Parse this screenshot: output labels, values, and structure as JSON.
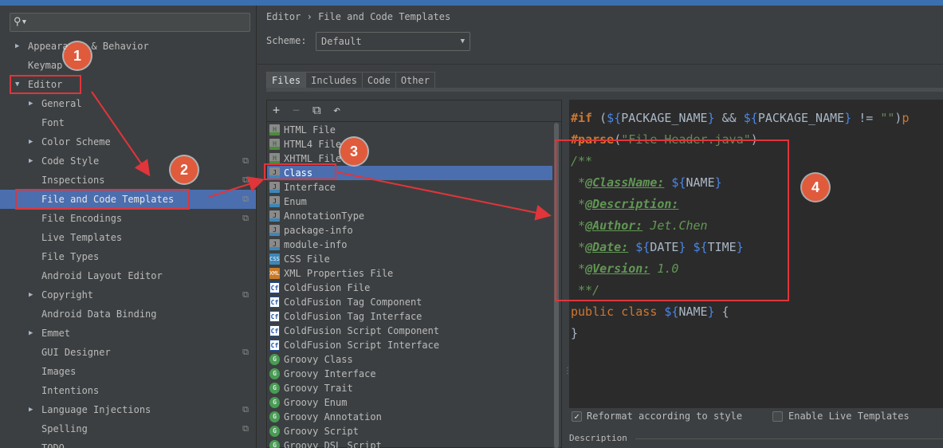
{
  "settings_tree": {
    "search_placeholder": "",
    "items": [
      {
        "label": "Appearance & Behavior",
        "expander": "right",
        "indent": 0,
        "project": false,
        "selected": false
      },
      {
        "label": "Keymap",
        "expander": "",
        "indent": 0,
        "project": false,
        "selected": false
      },
      {
        "label": "Editor",
        "expander": "down",
        "indent": 0,
        "project": false,
        "selected": false
      },
      {
        "label": "General",
        "expander": "right",
        "indent": 1,
        "project": false,
        "selected": false
      },
      {
        "label": "Font",
        "expander": "",
        "indent": 1,
        "project": false,
        "selected": false
      },
      {
        "label": "Color Scheme",
        "expander": "right",
        "indent": 1,
        "project": false,
        "selected": false
      },
      {
        "label": "Code Style",
        "expander": "right",
        "indent": 1,
        "project": true,
        "selected": false
      },
      {
        "label": "Inspections",
        "expander": "",
        "indent": 1,
        "project": true,
        "selected": false
      },
      {
        "label": "File and Code Templates",
        "expander": "",
        "indent": 1,
        "project": true,
        "selected": true
      },
      {
        "label": "File Encodings",
        "expander": "",
        "indent": 1,
        "project": true,
        "selected": false
      },
      {
        "label": "Live Templates",
        "expander": "",
        "indent": 1,
        "project": false,
        "selected": false
      },
      {
        "label": "File Types",
        "expander": "",
        "indent": 1,
        "project": false,
        "selected": false
      },
      {
        "label": "Android Layout Editor",
        "expander": "",
        "indent": 1,
        "project": false,
        "selected": false
      },
      {
        "label": "Copyright",
        "expander": "right",
        "indent": 1,
        "project": true,
        "selected": false
      },
      {
        "label": "Android Data Binding",
        "expander": "",
        "indent": 1,
        "project": false,
        "selected": false
      },
      {
        "label": "Emmet",
        "expander": "right",
        "indent": 1,
        "project": false,
        "selected": false
      },
      {
        "label": "GUI Designer",
        "expander": "",
        "indent": 1,
        "project": true,
        "selected": false
      },
      {
        "label": "Images",
        "expander": "",
        "indent": 1,
        "project": false,
        "selected": false
      },
      {
        "label": "Intentions",
        "expander": "",
        "indent": 1,
        "project": false,
        "selected": false
      },
      {
        "label": "Language Injections",
        "expander": "right",
        "indent": 1,
        "project": true,
        "selected": false
      },
      {
        "label": "Spelling",
        "expander": "",
        "indent": 1,
        "project": true,
        "selected": false
      },
      {
        "label": "TODO",
        "expander": "",
        "indent": 1,
        "project": false,
        "selected": false
      }
    ]
  },
  "header": {
    "breadcrumb_root": "Editor",
    "breadcrumb_sep": "›",
    "breadcrumb_page": "File and Code Templates",
    "scheme_label": "Scheme:",
    "scheme_value": "Default"
  },
  "tabs": [
    {
      "label": "Files",
      "active": true
    },
    {
      "label": "Includes",
      "active": false
    },
    {
      "label": "Code",
      "active": false
    },
    {
      "label": "Other",
      "active": false
    }
  ],
  "toolbar": {
    "add": "+",
    "remove": "−",
    "copy": "⧉",
    "reset": "↶"
  },
  "templates": [
    {
      "name": "HTML File",
      "icon": "H",
      "type": "h"
    },
    {
      "name": "HTML4 File",
      "icon": "H",
      "type": "h"
    },
    {
      "name": "XHTML File",
      "icon": "H",
      "type": "h"
    },
    {
      "name": "Class",
      "icon": "J",
      "type": "j",
      "selected": true
    },
    {
      "name": "Interface",
      "icon": "J",
      "type": "j"
    },
    {
      "name": "Enum",
      "icon": "J",
      "type": "j"
    },
    {
      "name": "AnnotationType",
      "icon": "J",
      "type": "j"
    },
    {
      "name": "package-info",
      "icon": "J",
      "type": "j"
    },
    {
      "name": "module-info",
      "icon": "J",
      "type": "j"
    },
    {
      "name": "CSS File",
      "icon": "CSS",
      "type": "css"
    },
    {
      "name": "XML Properties File",
      "icon": "XML",
      "type": "xml"
    },
    {
      "name": "ColdFusion File",
      "icon": "Cf",
      "type": "cf"
    },
    {
      "name": "ColdFusion Tag Component",
      "icon": "Cf",
      "type": "cf"
    },
    {
      "name": "ColdFusion Tag Interface",
      "icon": "Cf",
      "type": "cf"
    },
    {
      "name": "ColdFusion Script Component",
      "icon": "Cf",
      "type": "cf"
    },
    {
      "name": "ColdFusion Script Interface",
      "icon": "Cf",
      "type": "cf"
    },
    {
      "name": "Groovy Class",
      "icon": "G",
      "type": "g"
    },
    {
      "name": "Groovy Interface",
      "icon": "G",
      "type": "g"
    },
    {
      "name": "Groovy Trait",
      "icon": "G",
      "type": "g"
    },
    {
      "name": "Groovy Enum",
      "icon": "G",
      "type": "g"
    },
    {
      "name": "Groovy Annotation",
      "icon": "G",
      "type": "g"
    },
    {
      "name": "Groovy Script",
      "icon": "G",
      "type": "g"
    },
    {
      "name": "Groovy DSL Script",
      "icon": "G",
      "type": "g"
    }
  ],
  "code": {
    "l1_if": "#if",
    "l1_open": " (",
    "l1_d1": "$",
    "l1_b1o": "{",
    "l1_v1": "PACKAGE_NAME",
    "l1_b1c": "}",
    "l1_and": " && ",
    "l1_d2": "$",
    "l1_b2o": "{",
    "l1_v2": "PACKAGE_NAME",
    "l1_b2c": "}",
    "l1_ne": " != ",
    "l1_str": "\"\"",
    "l1_close": ")",
    "l1_p": "p",
    "l2_parse": "#parse",
    "l2_open": "(",
    "l2_str": "\"File Header.java\"",
    "l2_close": ")",
    "l3": "/**",
    "l4_pre": " *",
    "l4_tag": "@ClassName:",
    "l4_d": " $",
    "l4_bo": "{",
    "l4_v": "NAME",
    "l4_bc": "}",
    "l5_pre": " *",
    "l5_tag": "@Description:",
    "l6_pre": " *",
    "l6_tag": "@Author:",
    "l6_val": " Jet.Chen",
    "l7_pre": " *",
    "l7_tag": "@Date:",
    "l7_d1": " $",
    "l7_b1o": "{",
    "l7_v1": "DATE",
    "l7_b1c": "}",
    "l7_d2": " $",
    "l7_b2o": "{",
    "l7_v2": "TIME",
    "l7_b2c": "}",
    "l8_pre": " *",
    "l8_tag": "@Version:",
    "l8_val": " 1.0",
    "l9": " **/",
    "l10_kw": "public class",
    "l10_d": " $",
    "l10_bo": "{",
    "l10_v": "NAME",
    "l10_bc": "}",
    "l10_rest": " {",
    "l11": "}"
  },
  "options": {
    "reformat_label": "Reformat according to style",
    "reformat_checked": true,
    "live_label": "Enable Live Templates",
    "live_checked": false,
    "description_label": "Description"
  },
  "annotations": {
    "c1": "1",
    "c2": "2",
    "c3": "3",
    "c4": "4",
    "color": "#e05a3c",
    "box_color": "#e0353a"
  }
}
